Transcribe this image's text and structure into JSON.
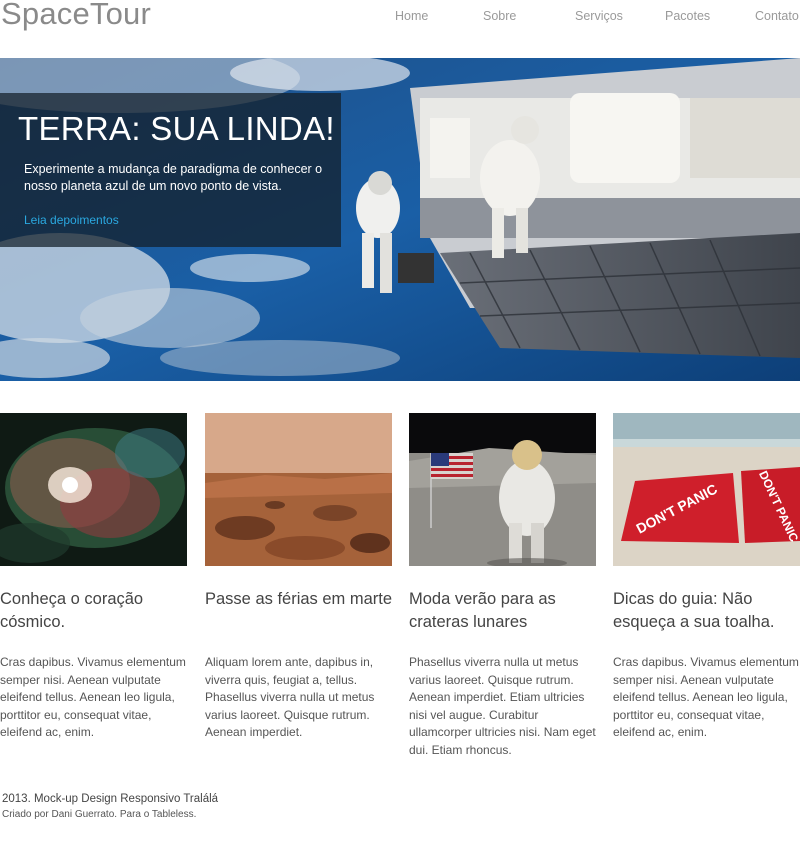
{
  "header": {
    "logo": "SpaceTour",
    "nav": [
      "Home",
      "Sobre",
      "Serviços",
      "Pacotes",
      "Contato"
    ]
  },
  "hero": {
    "title": "TERRA: SUA LINDA!",
    "text": "Experimente a mudança de paradigma de conhecer o nosso planeta azul de um novo ponto de vista.",
    "link": "Leia depoimentos"
  },
  "cards": [
    {
      "title": "Conheça o coração cósmico.",
      "text": "Cras dapibus. Vivamus elementum semper nisi. Aenean vulputate eleifend tellus. Aenean leo ligula, porttitor eu, consequat vitae, eleifend ac, enim."
    },
    {
      "title": "Passe as férias em marte",
      "text": "Aliquam lorem ante, dapibus in, viverra quis, feugiat a, tellus. Phasellus viverra nulla ut metus varius laoreet. Quisque rutrum. Aenean imperdiet."
    },
    {
      "title": "Moda verão para as crateras lunares",
      "text": "Phasellus viverra nulla ut metus varius laoreet. Quisque rutrum. Aenean imperdiet. Etiam ultricies nisi vel augue. Curabitur ullamcorper ultricies nisi. Nam eget dui. Etiam rhoncus."
    },
    {
      "title": "Dicas do guia: Não esqueça a sua toalha.",
      "text": "Cras dapibus. Vivamus elementum semper nisi. Aenean vulputate eleifend tellus. Aenean leo ligula, porttitor eu, consequat vitae, eleifend ac, enim."
    }
  ],
  "towel_text": "DON'T PANIC",
  "footer": {
    "line1": "2013. Mock-up Design Responsivo Tralálá",
    "line2": "Criado por Dani Guerrato. Para o Tableless."
  },
  "colors": {
    "link": "#2aa8e0",
    "nav": "#9a9a9a",
    "logo": "#8a8a8a"
  }
}
